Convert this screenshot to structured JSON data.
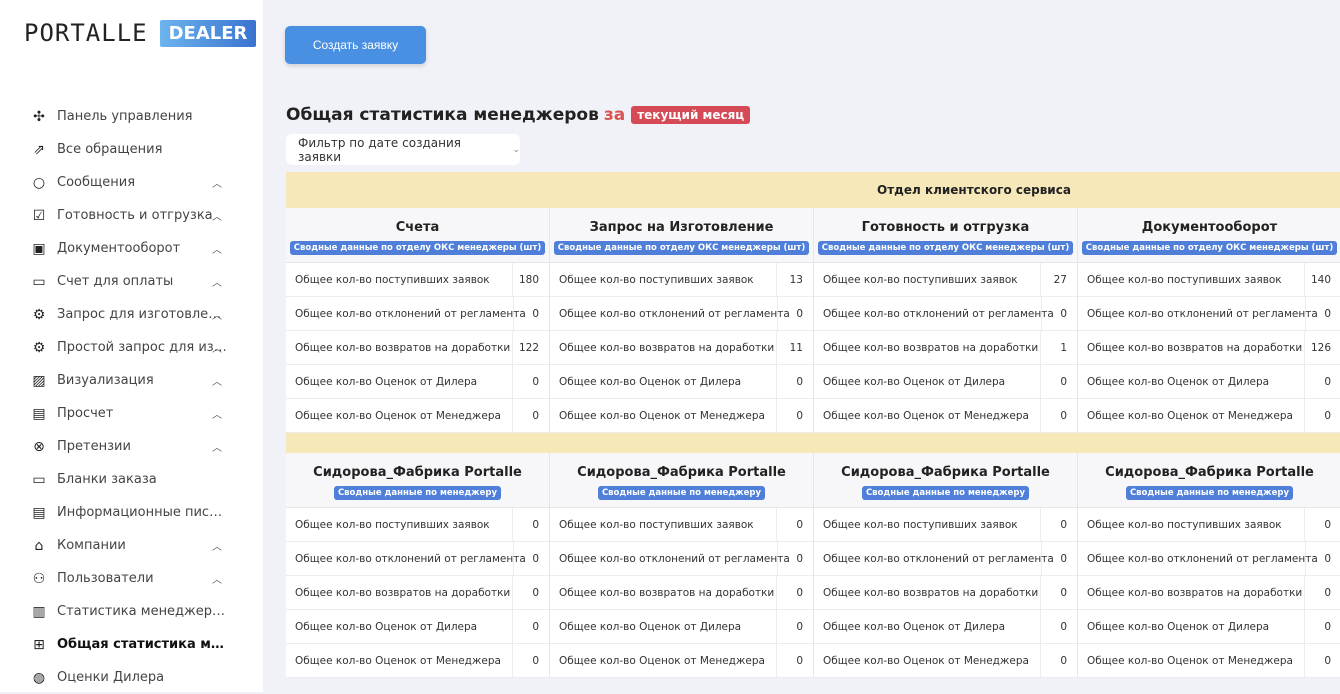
{
  "logo": {
    "text": "PORTALLE",
    "badge": "DEALER"
  },
  "sidebar": {
    "items": [
      {
        "icon": "puzzle-icon",
        "glyph": "✣",
        "label": "Панель управления",
        "chevron": false
      },
      {
        "icon": "share-icon",
        "glyph": "⇗",
        "label": "Все обращения",
        "chevron": false
      },
      {
        "icon": "chat-bubble-icon",
        "glyph": "○",
        "label": "Сообщения",
        "chevron": true
      },
      {
        "icon": "checkbox-stack-icon",
        "glyph": "☑",
        "label": "Готовность и отгрузка",
        "chevron": true
      },
      {
        "icon": "archive-box-icon",
        "glyph": "▣",
        "label": "Документооборот",
        "chevron": true
      },
      {
        "icon": "invoice-icon",
        "glyph": "▭",
        "label": "Счет для оплаты",
        "chevron": true
      },
      {
        "icon": "gear-icon",
        "glyph": "⚙",
        "label": "Запрос для изготовления",
        "chevron": true
      },
      {
        "icon": "gears-icon",
        "glyph": "⚙",
        "label": "Простой запрос для изготовления",
        "chevron": true
      },
      {
        "icon": "image-icon",
        "glyph": "▨",
        "label": "Визуализация",
        "chevron": true
      },
      {
        "icon": "document-icon",
        "glyph": "▤",
        "label": "Просчет",
        "chevron": true
      },
      {
        "icon": "x-circle-icon",
        "glyph": "⊗",
        "label": "Претензии",
        "chevron": true
      },
      {
        "icon": "folder-icon",
        "glyph": "▭",
        "label": "Бланки заказа",
        "chevron": false
      },
      {
        "icon": "newspaper-icon",
        "glyph": "▤",
        "label": "Информационные письма",
        "chevron": false
      },
      {
        "icon": "building-icon",
        "glyph": "⌂",
        "label": "Компании",
        "chevron": true
      },
      {
        "icon": "users-icon",
        "glyph": "⚇",
        "label": "Пользователи",
        "chevron": true
      },
      {
        "icon": "bar-chart-icon",
        "glyph": "▥",
        "label": "Статистика менеджеров",
        "chevron": false
      },
      {
        "icon": "grid-icon",
        "glyph": "⊞",
        "label": "Общая статистика менеджеров",
        "chevron": false,
        "active": true
      },
      {
        "icon": "volleyball-icon",
        "glyph": "◍",
        "label": "Оценки Дилера",
        "chevron": false
      }
    ]
  },
  "create_button": "Создать заявку",
  "header": {
    "title": "Общая статистика менеджеров",
    "za": "за",
    "period": "текущий месяц"
  },
  "filter": {
    "label": "Фильтр по дате создания заявки"
  },
  "table": {
    "department": "Отдел клиентского сервиса",
    "row_labels": [
      "Общее кол-во поступивших заявок",
      "Общее кол-во отклонений от регламента",
      "Общее кол-во возвратов на доработки",
      "Общее кол-во Оценок от Дилера",
      "Общее кол-во Оценок от Менеджера"
    ],
    "sections": [
      {
        "columns": [
          {
            "title": "Счета",
            "tag": "Сводные данные по отделу ОКС менеджеры (шт)",
            "values": [
              "180",
              "0",
              "122",
              "0",
              "0"
            ]
          },
          {
            "title": "Запрос на Изготовление",
            "tag": "Сводные данные по отделу ОКС менеджеры (шт)",
            "values": [
              "13",
              "0",
              "11",
              "0",
              "0"
            ]
          },
          {
            "title": "Готовность и отгрузка",
            "tag": "Сводные данные по отделу ОКС менеджеры (шт)",
            "values": [
              "27",
              "0",
              "1",
              "0",
              "0"
            ]
          },
          {
            "title": "Документооборот",
            "tag": "Сводные данные по отделу ОКС менеджеры (шт)",
            "values": [
              "140",
              "0",
              "126",
              "0",
              "0"
            ]
          }
        ]
      },
      {
        "columns": [
          {
            "title": "Сидорова_Фабрика Portalle",
            "tag": "Сводные данные по менеджеру",
            "values": [
              "0",
              "0",
              "0",
              "0",
              "0"
            ]
          },
          {
            "title": "Сидорова_Фабрика Portalle",
            "tag": "Сводные данные по менеджеру",
            "values": [
              "0",
              "0",
              "0",
              "0",
              "0"
            ]
          },
          {
            "title": "Сидорова_Фабрика Portalle",
            "tag": "Сводные данные по менеджеру",
            "values": [
              "0",
              "0",
              "0",
              "0",
              "0"
            ]
          },
          {
            "title": "Сидорова_Фабрика Portalle",
            "tag": "Сводные данные по менеджеру",
            "values": [
              "0",
              "0",
              "0",
              "0",
              "0"
            ]
          }
        ]
      }
    ]
  }
}
